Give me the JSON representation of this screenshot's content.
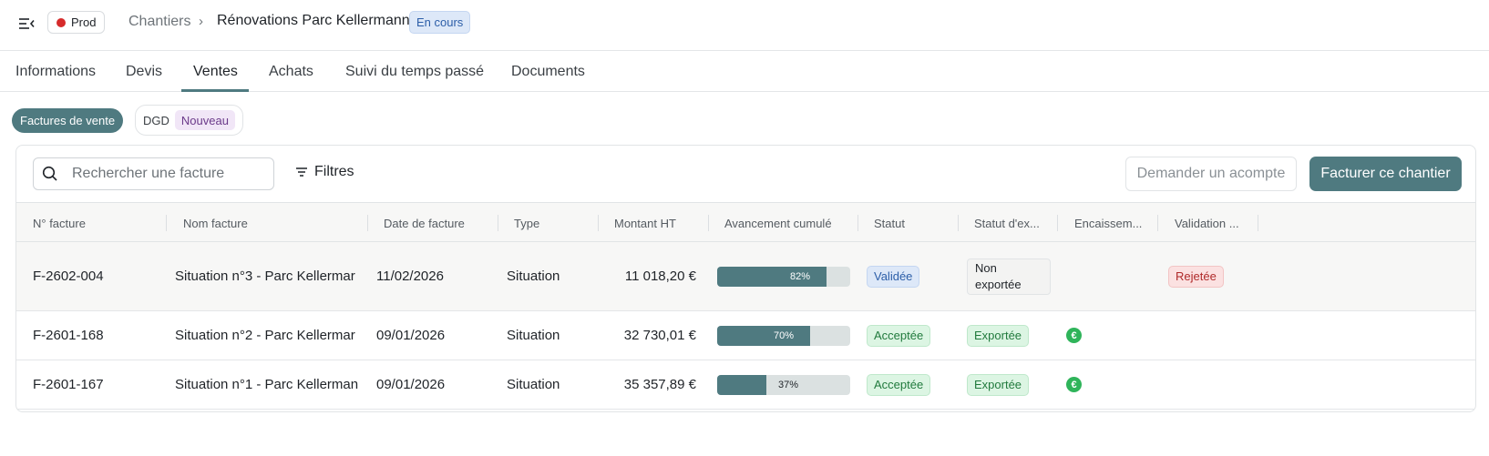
{
  "header": {
    "env_label": "Prod",
    "env_color": "#d62b2b",
    "breadcrumb_parent": "Chantiers",
    "breadcrumb_separator": "›",
    "breadcrumb_current": "Rénovations Parc Kellermann",
    "status": "En cours"
  },
  "tabs": [
    {
      "label": "Informations"
    },
    {
      "label": "Devis"
    },
    {
      "label": "Ventes",
      "active": true
    },
    {
      "label": "Achats"
    },
    {
      "label": "Suivi du temps passé"
    },
    {
      "label": "Documents"
    }
  ],
  "subtabs": {
    "active_label": "Factures de vente",
    "dgd_label": "DGD",
    "dgd_badge": "Nouveau"
  },
  "toolbar": {
    "search_placeholder": "Rechercher une facture",
    "filters_label": "Filtres",
    "acompte_label": "Demander un acompte",
    "facturer_label": "Facturer ce chantier"
  },
  "table": {
    "columns": [
      "N° facture",
      "Nom facture",
      "Date de facture",
      "Type",
      "Montant HT",
      "Avancement cumulé",
      "Statut",
      "Statut d'ex...",
      "Encaissem...",
      "Validation ..."
    ],
    "rows": [
      {
        "numero": "F-2602-004",
        "nom": "Situation n°3 - Parc Kellermar",
        "date": "11/02/2026",
        "type": "Situation",
        "montant": "11 018,20 €",
        "avancement": 0.82,
        "avancement_label": "82%",
        "statut": "Validée",
        "export": "Non exportée",
        "encaissement": false,
        "validation": "Rejetée"
      },
      {
        "numero": "F-2601-168",
        "nom": "Situation n°2 - Parc Kellermar",
        "date": "09/01/2026",
        "type": "Situation",
        "montant": "32 730,01 €",
        "avancement": 0.7,
        "avancement_label": "70%",
        "statut": "Acceptée",
        "export": "Exportée",
        "encaissement": true,
        "validation": ""
      },
      {
        "numero": "F-2601-167",
        "nom": "Situation n°1 - Parc Kellerman",
        "date": "09/01/2026",
        "type": "Situation",
        "montant": "35 357,89 €",
        "avancement": 0.37,
        "avancement_label": "37%",
        "statut": "Acceptée",
        "export": "Exportée",
        "encaissement": true,
        "validation": ""
      }
    ]
  },
  "icons": {
    "menu": "menu-collapse-icon",
    "search": "search-icon",
    "filter": "filter-icon",
    "encaissement": "euro-icon"
  },
  "colors": {
    "primary": "#4f7a80",
    "validee_bg": "#dde8f8",
    "acceptee_bg": "#dcf5e3",
    "rejetee_bg": "#fbe1e1"
  }
}
